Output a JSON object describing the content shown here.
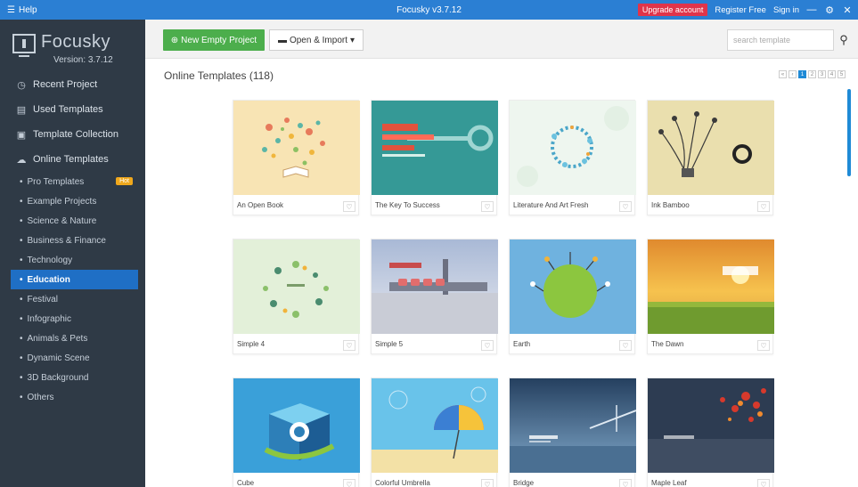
{
  "titlebar": {
    "help_label": "Help",
    "app_title": "Focusky v3.7.12",
    "upgrade_label": "Upgrade account",
    "register_label": "Register Free",
    "signin_label": "Sign in"
  },
  "brand": {
    "name": "Focusky",
    "version": "Version: 3.7.12"
  },
  "sidebar": {
    "main_items": [
      {
        "label": "Recent Project",
        "icon": "clock-icon"
      },
      {
        "label": "Used Templates",
        "icon": "list-icon"
      },
      {
        "label": "Template Collection",
        "icon": "collection-icon"
      },
      {
        "label": "Online Templates",
        "icon": "cloud-icon"
      }
    ],
    "sub_items": [
      {
        "label": "Pro Templates",
        "badge": "Hot"
      },
      {
        "label": "Example Projects"
      },
      {
        "label": "Science & Nature"
      },
      {
        "label": "Business & Finance"
      },
      {
        "label": "Technology"
      },
      {
        "label": "Education",
        "active": true
      },
      {
        "label": "Festival"
      },
      {
        "label": "Infographic"
      },
      {
        "label": "Animals & Pets"
      },
      {
        "label": "Dynamic Scene"
      },
      {
        "label": "3D Background"
      },
      {
        "label": "Others"
      }
    ]
  },
  "toolbar": {
    "new_project_label": "New Empty Project",
    "open_import_label": "Open & Import",
    "search_placeholder": "search template"
  },
  "section": {
    "title": "Online Templates (118)"
  },
  "pager": {
    "pages": [
      "1",
      "2",
      "3",
      "4",
      "5"
    ],
    "current": "1"
  },
  "templates": [
    {
      "title": "An Open Book"
    },
    {
      "title": "The Key To Success"
    },
    {
      "title": "Literature And Art Fresh"
    },
    {
      "title": "Ink Bamboo"
    },
    {
      "title": "Simple 4"
    },
    {
      "title": "Simple 5"
    },
    {
      "title": "Earth"
    },
    {
      "title": "The Dawn"
    },
    {
      "title": "Cube"
    },
    {
      "title": "Colorful Umbrella"
    },
    {
      "title": "Bridge"
    },
    {
      "title": "Maple Leaf"
    }
  ],
  "colors": {
    "titlebar": "#2b7fd3",
    "sidebar": "#2f3a46",
    "active_item": "#1f6fc5",
    "new_button": "#4cae4c",
    "upgrade": "#e0344a"
  }
}
